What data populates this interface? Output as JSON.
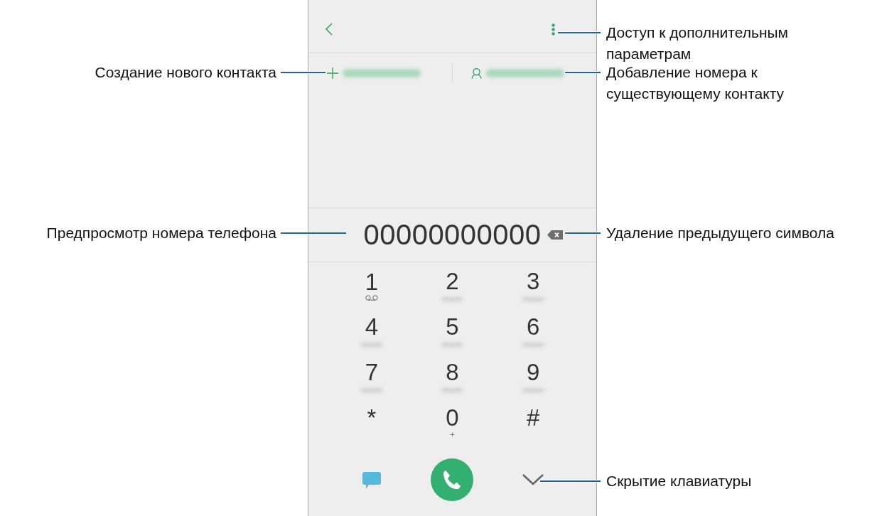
{
  "phone": {
    "actions": [
      {
        "kind": "add"
      },
      {
        "kind": "person"
      }
    ],
    "number": "00000000000",
    "keys": [
      {
        "label": "1",
        "kind": "voicemail"
      },
      {
        "label": "2",
        "kind": "blurred"
      },
      {
        "label": "3",
        "kind": "blurred"
      },
      {
        "label": "4",
        "kind": "blurred"
      },
      {
        "label": "5",
        "kind": "blurred"
      },
      {
        "label": "6",
        "kind": "blurred"
      },
      {
        "label": "7",
        "kind": "blurred"
      },
      {
        "label": "8",
        "kind": "blurred"
      },
      {
        "label": "9",
        "kind": "blurred"
      },
      {
        "label": "*",
        "kind": "plain"
      },
      {
        "label": "0",
        "kind": "text",
        "sub_text": "+"
      },
      {
        "label": "#",
        "kind": "plain"
      }
    ],
    "bottom": [
      {
        "kind": "message"
      },
      {
        "kind": "call"
      },
      {
        "kind": "hide"
      }
    ]
  },
  "callouts": [
    {
      "kind": "create_contact",
      "text": "Создание нового контакта"
    },
    {
      "kind": "preview_number",
      "text": "Предпросмотр номера телефона"
    },
    {
      "kind": "more",
      "text": "Доступ к дополнительным параметрам"
    },
    {
      "kind": "add_existing",
      "text": "Добавление номера к существующему контакту"
    },
    {
      "kind": "backspace",
      "text": "Удаление предыдущего символа"
    },
    {
      "kind": "hide_keypad",
      "text": "Скрытие клавиатуры"
    }
  ]
}
